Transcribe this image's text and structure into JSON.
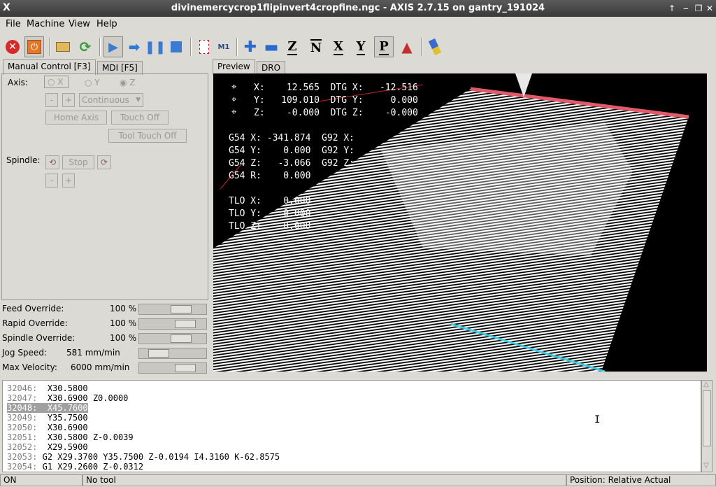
{
  "window": {
    "title": "divinemercycrop1flipinvert4cropfine.ngc - AXIS 2.7.15 on gantry_191024"
  },
  "menu": {
    "file": "File",
    "machine": "Machine",
    "view": "View",
    "help": "Help"
  },
  "tabs": {
    "manual": "Manual Control [F3]",
    "mdi": "MDI [F5]",
    "preview": "Preview",
    "dro": "DRO"
  },
  "manual": {
    "axis_label": "Axis:",
    "axis_x": "X",
    "axis_y": "Y",
    "axis_z": "Z",
    "minus": "-",
    "plus": "+",
    "jog_mode": "Continuous",
    "home_axis": "Home Axis",
    "touch_off": "Touch Off",
    "tool_touch_off": "Tool Touch Off",
    "spindle_label": "Spindle:",
    "stop": "Stop"
  },
  "overrides": {
    "feed_label": "Feed Override:",
    "feed_value": "100 %",
    "feed_frac": 0.7,
    "rapid_label": "Rapid Override:",
    "rapid_value": "100 %",
    "rapid_frac": 0.8,
    "spindle_label": "Spindle Override:",
    "spindle_value": "100 %",
    "spindle_frac": 0.7,
    "jog_label": "Jog Speed:",
    "jog_value": "581 mm/min",
    "jog_frac": 0.2,
    "maxvel_label": "Max Velocity:",
    "maxvel_value": "6000 mm/min",
    "maxvel_frac": 0.8
  },
  "dro": {
    "rows": [
      "X:    12.565  DTG X:   -12.516",
      "Y:   109.010  DTG Y:     0.000",
      "Z:    -0.000  DTG Z:    -0.000",
      "",
      "G54 X: -341.874  G92 X:",
      "G54 Y:    0.000  G92 Y:",
      "G54 Z:   -3.066  G92 Z:",
      "G54 R:    0.000",
      "",
      "TLO X:    0.000",
      "TLO Y:    0.000",
      "TLO Z:    0.000"
    ]
  },
  "gcode": [
    {
      "num": "32046:",
      "text": "X30.5800"
    },
    {
      "num": "32047:",
      "text": "X30.6900 Z0.0000"
    },
    {
      "num": "32048:",
      "text": "X45.7600"
    },
    {
      "num": "32049:",
      "text": "Y35.7500"
    },
    {
      "num": "32050:",
      "text": "X30.6900"
    },
    {
      "num": "32051:",
      "text": "X30.5800 Z-0.0039"
    },
    {
      "num": "32052:",
      "text": "X29.5900"
    },
    {
      "num": "32053:",
      "text": "G2 X29.3700 Y35.7500 Z-0.0194 I4.3160 K-62.8575"
    },
    {
      "num": "32054:",
      "text": "G1 X29.2600 Z-0.0312"
    }
  ],
  "status": {
    "state": "ON",
    "tool": "No tool",
    "position": "Position: Relative Actual"
  }
}
